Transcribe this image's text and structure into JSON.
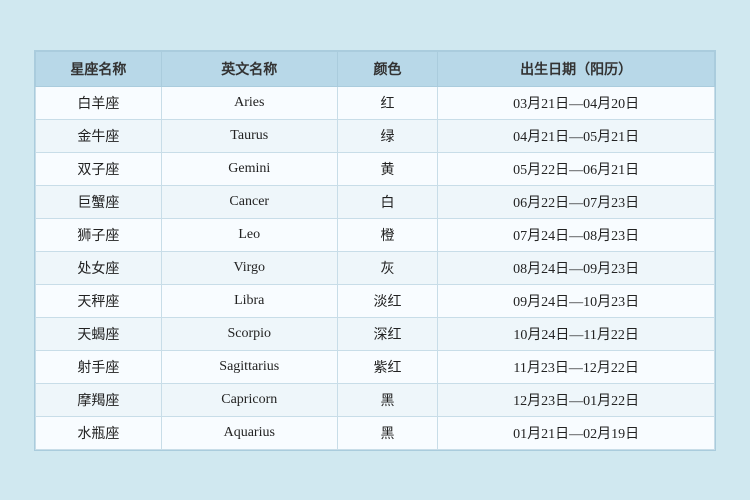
{
  "table": {
    "headers": [
      "星座名称",
      "英文名称",
      "颜色",
      "出生日期（阳历）"
    ],
    "rows": [
      {
        "zh": "白羊座",
        "en": "Aries",
        "color": "红",
        "date": "03月21日—04月20日"
      },
      {
        "zh": "金牛座",
        "en": "Taurus",
        "color": "绿",
        "date": "04月21日—05月21日"
      },
      {
        "zh": "双子座",
        "en": "Gemini",
        "color": "黄",
        "date": "05月22日—06月21日"
      },
      {
        "zh": "巨蟹座",
        "en": "Cancer",
        "color": "白",
        "date": "06月22日—07月23日"
      },
      {
        "zh": "狮子座",
        "en": "Leo",
        "color": "橙",
        "date": "07月24日—08月23日"
      },
      {
        "zh": "处女座",
        "en": "Virgo",
        "color": "灰",
        "date": "08月24日—09月23日"
      },
      {
        "zh": "天秤座",
        "en": "Libra",
        "color": "淡红",
        "date": "09月24日—10月23日"
      },
      {
        "zh": "天蝎座",
        "en": "Scorpio",
        "color": "深红",
        "date": "10月24日—11月22日"
      },
      {
        "zh": "射手座",
        "en": "Sagittarius",
        "color": "紫红",
        "date": "11月23日—12月22日"
      },
      {
        "zh": "摩羯座",
        "en": "Capricorn",
        "color": "黑",
        "date": "12月23日—01月22日"
      },
      {
        "zh": "水瓶座",
        "en": "Aquarius",
        "color": "黑",
        "date": "01月21日—02月19日"
      }
    ]
  }
}
